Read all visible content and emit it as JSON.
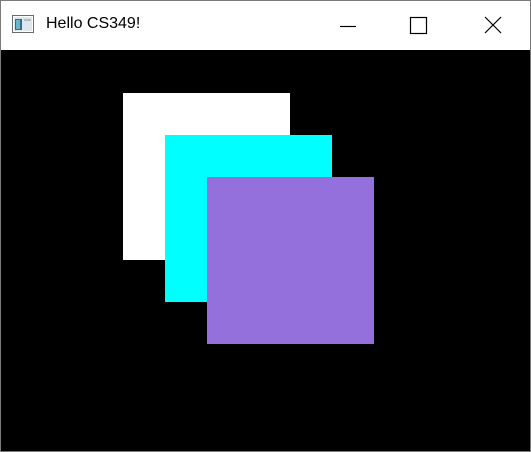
{
  "window": {
    "title": "Hello CS349!",
    "icon": "app-window-icon",
    "controls": {
      "minimize_icon": "minimize-icon",
      "maximize_icon": "maximize-icon",
      "close_icon": "close-icon"
    }
  },
  "canvas": {
    "background_color": "#000000",
    "squares": [
      {
        "name": "white-square",
        "color": "#ffffff"
      },
      {
        "name": "cyan-square",
        "color": "#00ffff"
      },
      {
        "name": "purple-square",
        "color": "#9370db"
      }
    ]
  }
}
